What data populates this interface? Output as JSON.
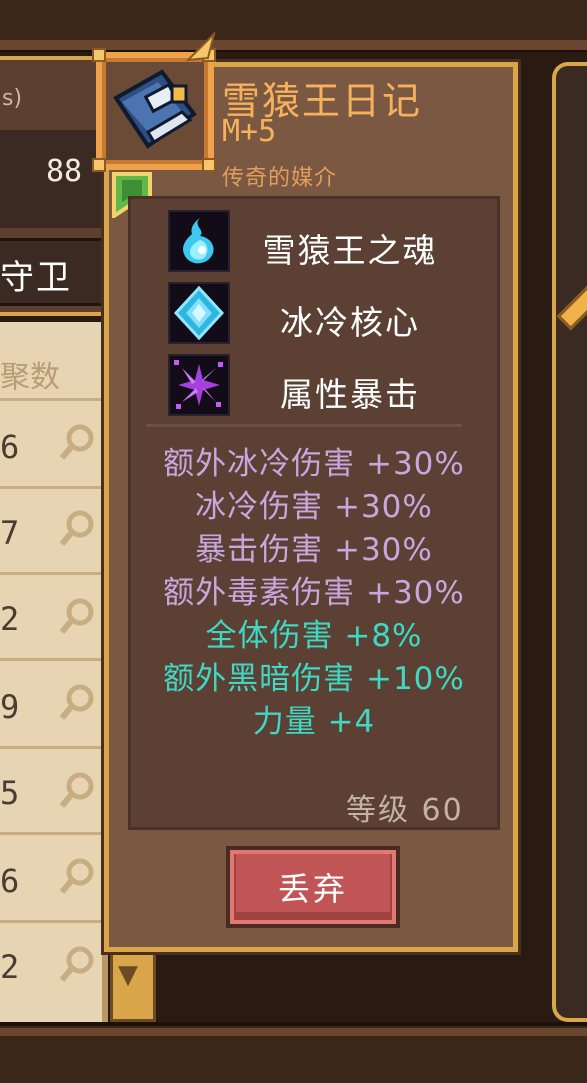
{
  "background": {
    "header_hint": "s)",
    "count_value": "88",
    "tab_label": "守卫",
    "column_header": "聚数",
    "row_numbers": [
      "6",
      "7",
      "2",
      "9",
      "5",
      "6",
      "2"
    ],
    "search_icon": "magnifier-icon"
  },
  "item": {
    "title": "雪猿王日记",
    "level_tag": "M+5",
    "type": "传奇的媒介",
    "rarity_color": "#f6b15d",
    "icon": "blue-book-icon",
    "equipped_badge_icon": "green-banner-icon"
  },
  "affixes": [
    {
      "label": "雪猿王之魂",
      "icon": "blue-flame-icon"
    },
    {
      "label": "冰冷核心",
      "icon": "ice-gem-icon"
    },
    {
      "label": "属性暴击",
      "icon": "purple-burst-icon"
    }
  ],
  "stats": [
    {
      "label": "额外冰冷伤害 +30%",
      "color": "purple"
    },
    {
      "label": "冰冷伤害 +30%",
      "color": "purple"
    },
    {
      "label": "暴击伤害 +30%",
      "color": "purple"
    },
    {
      "label": "额外毒素伤害 +30%",
      "color": "purple"
    },
    {
      "label": "全体伤害 +8%",
      "color": "teal"
    },
    {
      "label": "额外黑暗伤害 +10%",
      "color": "teal"
    },
    {
      "label": "力量 +4",
      "color": "teal"
    }
  ],
  "requirement": "等级 60",
  "actions": {
    "discard_label": "丢弃"
  },
  "colors": {
    "purple": "#c7a7de",
    "teal": "#3fd8c2",
    "gold_border": "#d9a64a",
    "discard_red": "#c15555"
  }
}
